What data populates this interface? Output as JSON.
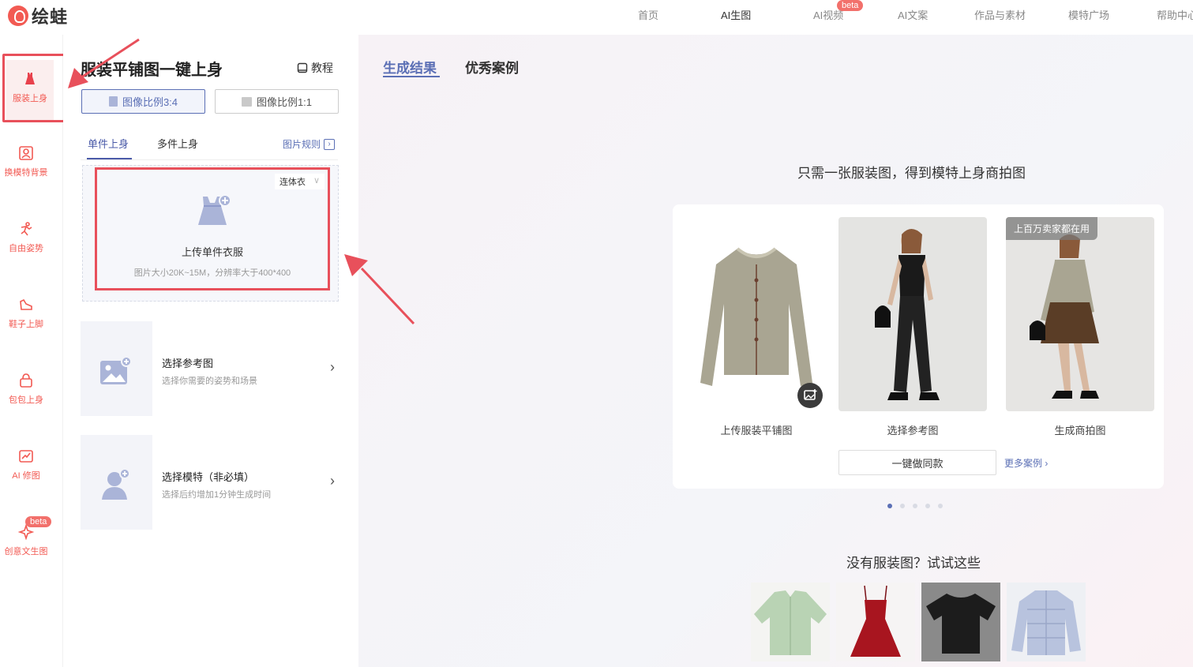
{
  "brand": {
    "name": "绘蛙"
  },
  "nav": {
    "items": [
      {
        "label": "首页"
      },
      {
        "label": "AI生图"
      },
      {
        "label": "AI视频",
        "badge": "beta"
      },
      {
        "label": "AI文案"
      },
      {
        "label": "作品与素材"
      },
      {
        "label": "模特广场"
      },
      {
        "label": "帮助中心"
      }
    ]
  },
  "sidebar": {
    "items": [
      {
        "label": "服装上身",
        "icon": "dress-icon"
      },
      {
        "label": "换模特背景",
        "icon": "portrait-icon"
      },
      {
        "label": "自由姿势",
        "icon": "pose-icon"
      },
      {
        "label": "鞋子上脚",
        "icon": "shoe-icon"
      },
      {
        "label": "包包上身",
        "icon": "bag-icon"
      },
      {
        "label": "AI 修图",
        "icon": "photo-edit-icon"
      },
      {
        "label": "创意文生图",
        "icon": "sparkle-icon",
        "badge": "beta"
      }
    ]
  },
  "panel": {
    "title": "服装平铺图一键上身",
    "tutorial": "教程",
    "ratios": [
      {
        "label": "图像比例3:4"
      },
      {
        "label": "图像比例1:1"
      }
    ],
    "tabs": [
      {
        "label": "单件上身"
      },
      {
        "label": "多件上身"
      }
    ],
    "rules_link": "图片规则",
    "upload": {
      "category": "连体衣",
      "title": "上传单件衣服",
      "hint": "图片大小20K~15M，分辨率大于400*400"
    },
    "reference": {
      "title": "选择参考图",
      "hint": "选择你需要的姿势和场景"
    },
    "model": {
      "title": "选择模特（非必填）",
      "hint": "选择后约增加1分钟生成时间"
    }
  },
  "main": {
    "tabs": [
      {
        "label": "生成结果"
      },
      {
        "label": "优秀案例"
      }
    ],
    "headline": "只需一张服装图，得到模特上身商拍图",
    "steps": [
      {
        "label": "上传服装平铺图"
      },
      {
        "label": "选择参考图"
      },
      {
        "label": "生成商拍图",
        "tag": "上百万卖家都在用"
      }
    ],
    "cta": "一键做同款",
    "more": "更多案例 ›",
    "carousel": {
      "count": 5,
      "active": 0
    },
    "samples_title": "没有服装图？试试这些",
    "samples": [
      {
        "name": "mint-shirt",
        "color": "#b9d3b4"
      },
      {
        "name": "red-dress",
        "color": "#a8151f"
      },
      {
        "name": "black-tshirt",
        "color": "#1c1c1c"
      },
      {
        "name": "blue-puffer",
        "color": "#b8c3de"
      }
    ]
  },
  "colors": {
    "accent": "#5b6fb5",
    "brand": "#f25a53",
    "annotation": "#e8505b"
  }
}
